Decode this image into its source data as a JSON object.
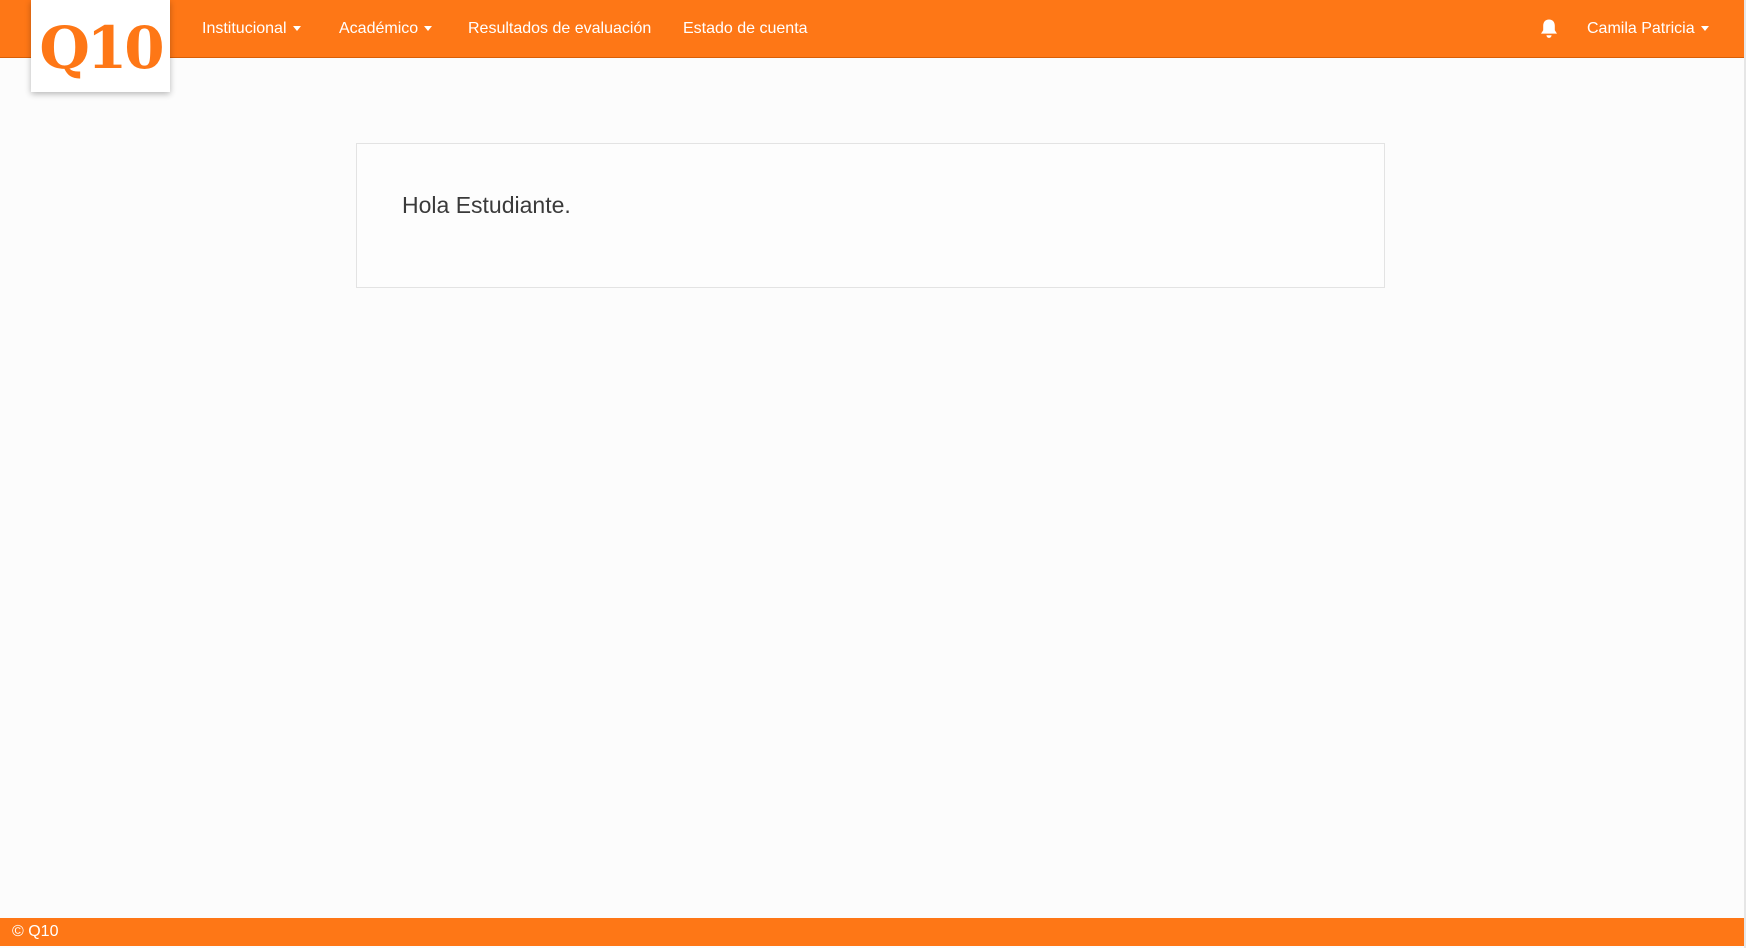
{
  "brand": {
    "logo_text": "Q10",
    "accent_color": "#fe7716"
  },
  "navbar": {
    "items": [
      {
        "label": "Institucional",
        "has_dropdown": true
      },
      {
        "label": "Académico",
        "has_dropdown": true
      },
      {
        "label": "Resultados de evaluación",
        "has_dropdown": false
      },
      {
        "label": "Estado de cuenta",
        "has_dropdown": false
      }
    ],
    "notifications_icon": "bell-icon",
    "user": {
      "name": "Camila Patricia",
      "has_dropdown": true
    }
  },
  "main": {
    "greeting": "Hola Estudiante."
  },
  "footer": {
    "text": "© Q10"
  }
}
